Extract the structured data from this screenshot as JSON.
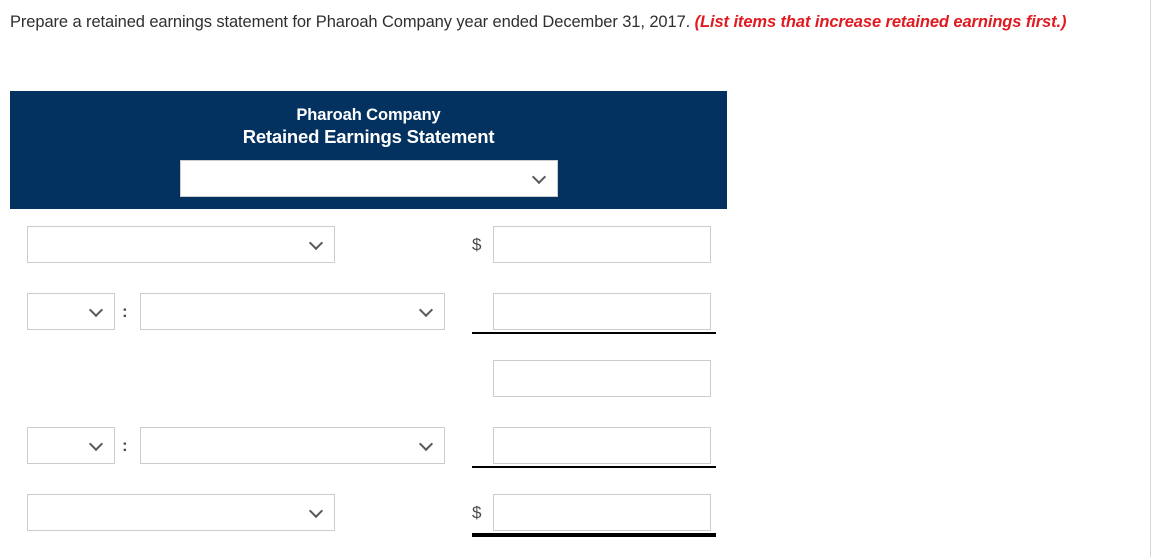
{
  "prompt": {
    "text": "Prepare a retained earnings statement for Pharoah Company year ended December 31, 2017.",
    "hint": "(List items that increase retained earnings first.)"
  },
  "statement_header": {
    "company_name": "Pharoah Company",
    "statement_title": "Retained Earnings Statement",
    "period_select": {
      "value": "",
      "icon": "chevron-down-icon"
    }
  },
  "symbols": {
    "dollar": "$",
    "colon": ":"
  },
  "rows": [
    {
      "id": "row-1-beginning-balance",
      "label_select": {
        "value": ""
      },
      "currency_symbol": "$",
      "amount": {
        "value": ""
      },
      "rule": "none"
    },
    {
      "id": "row-2-add-item",
      "prefix_select": {
        "value": ""
      },
      "separator": ":",
      "label_select": {
        "value": ""
      },
      "currency_symbol": "",
      "amount": {
        "value": ""
      },
      "rule": "single"
    },
    {
      "id": "row-3-subtotal",
      "currency_symbol": "",
      "amount": {
        "value": ""
      },
      "rule": "none"
    },
    {
      "id": "row-4-less-item",
      "prefix_select": {
        "value": ""
      },
      "separator": ":",
      "label_select": {
        "value": ""
      },
      "currency_symbol": "",
      "amount": {
        "value": ""
      },
      "rule": "single"
    },
    {
      "id": "row-5-ending-balance",
      "label_select": {
        "value": ""
      },
      "currency_symbol": "$",
      "amount": {
        "value": ""
      },
      "rule": "double"
    }
  ],
  "colors": {
    "header_navy": "#033160",
    "hint_red": "#e01a21",
    "body_text": "#2f2f2f",
    "border_gray": "#cccccc",
    "rule_black": "#000000"
  }
}
